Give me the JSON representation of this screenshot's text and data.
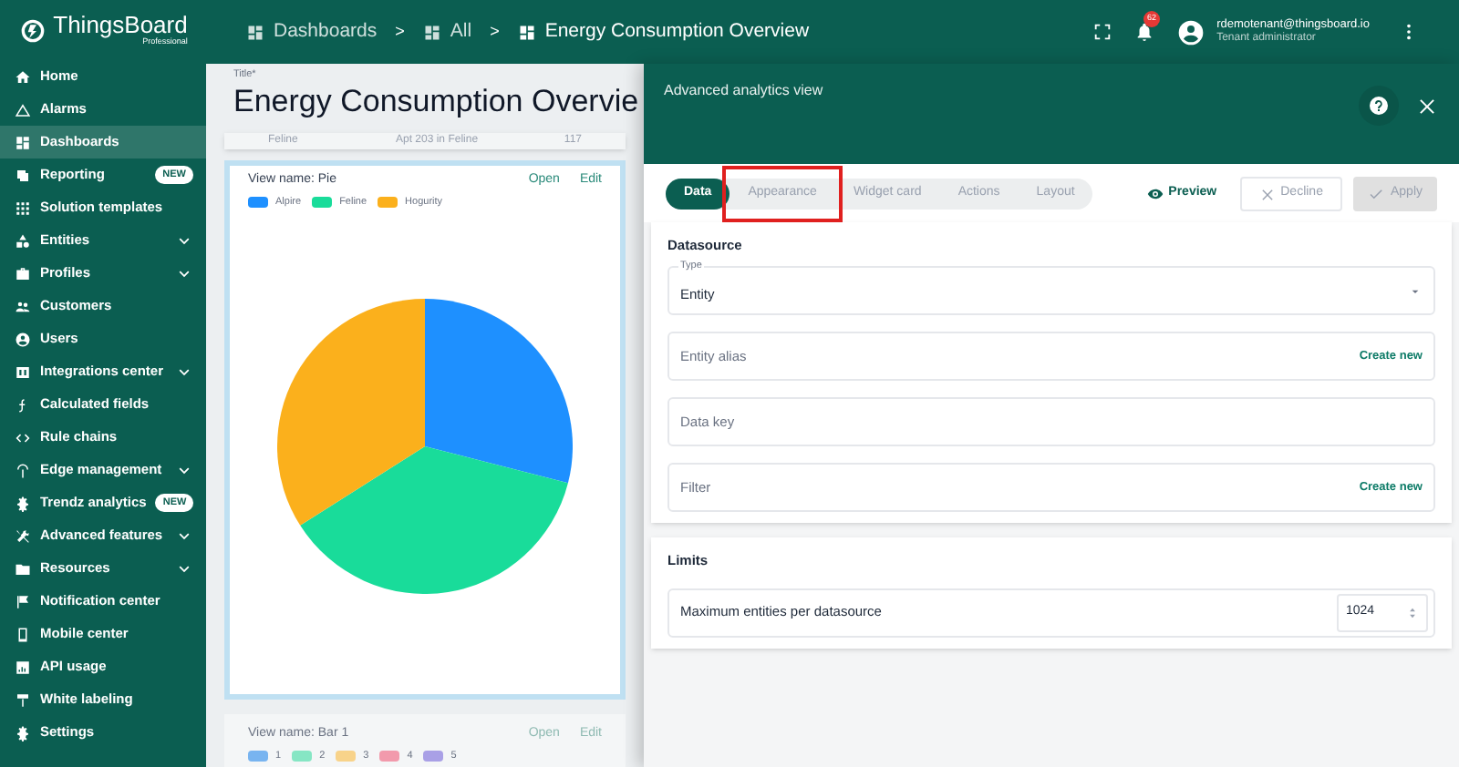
{
  "sidebar": {
    "logo": {
      "name": "ThingsBoard",
      "edition": "Professional"
    },
    "items": [
      {
        "label": "Home",
        "selected": false,
        "expandable": false
      },
      {
        "label": "Alarms",
        "selected": false,
        "expandable": false
      },
      {
        "label": "Dashboards",
        "selected": true,
        "expandable": false
      },
      {
        "label": "Reporting",
        "selected": false,
        "expandable": false,
        "badge": "NEW"
      },
      {
        "label": "Solution templates",
        "selected": false,
        "expandable": false
      },
      {
        "label": "Entities",
        "selected": false,
        "expandable": true
      },
      {
        "label": "Profiles",
        "selected": false,
        "expandable": true
      },
      {
        "label": "Customers",
        "selected": false,
        "expandable": false
      },
      {
        "label": "Users",
        "selected": false,
        "expandable": false
      },
      {
        "label": "Integrations center",
        "selected": false,
        "expandable": true
      },
      {
        "label": "Calculated fields",
        "selected": false,
        "expandable": false
      },
      {
        "label": "Rule chains",
        "selected": false,
        "expandable": false
      },
      {
        "label": "Edge management",
        "selected": false,
        "expandable": true
      },
      {
        "label": "Trendz analytics",
        "selected": false,
        "expandable": false,
        "badge": "NEW"
      },
      {
        "label": "Advanced features",
        "selected": false,
        "expandable": true
      },
      {
        "label": "Resources",
        "selected": false,
        "expandable": true
      },
      {
        "label": "Notification center",
        "selected": false,
        "expandable": false
      },
      {
        "label": "Mobile center",
        "selected": false,
        "expandable": false
      },
      {
        "label": "API usage",
        "selected": false,
        "expandable": false
      },
      {
        "label": "White labeling",
        "selected": false,
        "expandable": false
      },
      {
        "label": "Settings",
        "selected": false,
        "expandable": false
      }
    ]
  },
  "top_bar": {
    "breadcrumbs": [
      "Dashboards",
      "All",
      "Energy Consumption Overview"
    ],
    "separator": ">",
    "notification_count": "62",
    "user": {
      "email": "rdemotenant@thingsboard.io",
      "role": "Tenant administrator"
    }
  },
  "dashboard": {
    "title_label": "Title*",
    "title": "Energy Consumption Overvie",
    "table_row": [
      "Feline",
      "Apt 203 in Feline",
      "117"
    ],
    "widgets": [
      {
        "kind": "pie",
        "view_name": "View name: Pie",
        "actions": [
          "Open",
          "Edit"
        ],
        "legend": [
          {
            "label": "Alpire",
            "color": "#1e90ff"
          },
          {
            "label": "Feline",
            "color": "#19dc9a"
          },
          {
            "label": "Hogurity",
            "color": "#fbb01c"
          }
        ]
      },
      {
        "kind": "bar",
        "view_name": "View name: Bar 1",
        "actions": [
          "Open",
          "Edit"
        ],
        "legend": [
          {
            "label": "1",
            "color": "#78b4f0"
          },
          {
            "label": "2",
            "color": "#86e6c4"
          },
          {
            "label": "3",
            "color": "#f8d38a"
          },
          {
            "label": "4",
            "color": "#f29aac"
          },
          {
            "label": "5",
            "color": "#a9a0e6"
          }
        ]
      }
    ]
  },
  "panel": {
    "title": "Advanced analytics view",
    "tabs": [
      {
        "label": "Data",
        "selected": true,
        "highlighted": false
      },
      {
        "label": "Appearance",
        "selected": false,
        "highlighted": true
      },
      {
        "label": "Widget card",
        "selected": false,
        "highlighted": false
      },
      {
        "label": "Actions",
        "selected": false,
        "highlighted": false
      },
      {
        "label": "Layout",
        "selected": false,
        "highlighted": false
      }
    ],
    "buttons": [
      {
        "kind": "preview",
        "label": "Preview",
        "disabled": false
      },
      {
        "kind": "decline",
        "label": "Decline",
        "disabled": true
      },
      {
        "kind": "apply",
        "label": "Apply",
        "disabled": true
      }
    ],
    "sections": [
      {
        "title": "Datasource",
        "fields": [
          {
            "kind": "select",
            "label": "Type",
            "value": "Entity"
          },
          {
            "kind": "text",
            "placeholder": "Entity alias",
            "action": "Create new"
          },
          {
            "kind": "text",
            "placeholder": "Data key"
          },
          {
            "kind": "text",
            "placeholder": "Filter",
            "action": "Create new"
          }
        ]
      },
      {
        "title": "Limits",
        "fields": [
          {
            "kind": "number",
            "label": "Maximum entities per datasource",
            "value": "1024"
          }
        ]
      }
    ]
  }
}
